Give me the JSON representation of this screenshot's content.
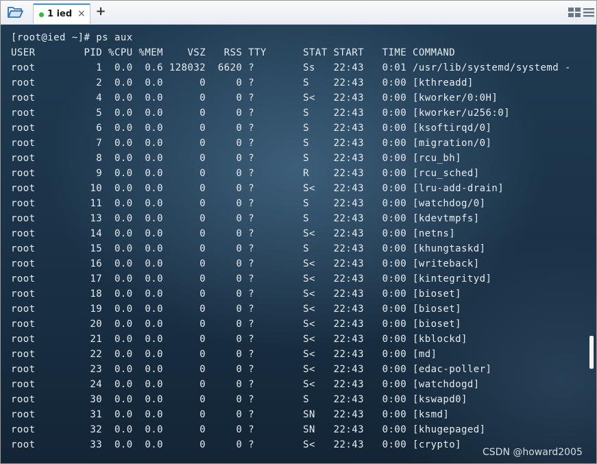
{
  "tabs": [
    {
      "label": "1 ied",
      "close_glyph": "×",
      "status_color": "#2cc12c"
    }
  ],
  "add_tab_glyph": "+",
  "icons": {
    "open": "folder-open-icon",
    "layout": "grid-layout-icon",
    "menu": "hamburger-menu-icon"
  },
  "terminal": {
    "lines": [
      "[root@ied ~]# ps aux",
      "USER        PID %CPU %MEM    VSZ   RSS TTY      STAT START   TIME COMMAND",
      "root          1  0.0  0.6 128032  6620 ?        Ss   22:43   0:01 /usr/lib/systemd/systemd -",
      "root          2  0.0  0.0      0     0 ?        S    22:43   0:00 [kthreadd]",
      "root          4  0.0  0.0      0     0 ?        S<   22:43   0:00 [kworker/0:0H]",
      "root          5  0.0  0.0      0     0 ?        S    22:43   0:00 [kworker/u256:0]",
      "root          6  0.0  0.0      0     0 ?        S    22:43   0:00 [ksoftirqd/0]",
      "root          7  0.0  0.0      0     0 ?        S    22:43   0:00 [migration/0]",
      "root          8  0.0  0.0      0     0 ?        S    22:43   0:00 [rcu_bh]",
      "root          9  0.0  0.0      0     0 ?        R    22:43   0:00 [rcu_sched]",
      "root         10  0.0  0.0      0     0 ?        S<   22:43   0:00 [lru-add-drain]",
      "root         11  0.0  0.0      0     0 ?        S    22:43   0:00 [watchdog/0]",
      "root         13  0.0  0.0      0     0 ?        S    22:43   0:00 [kdevtmpfs]",
      "root         14  0.0  0.0      0     0 ?        S<   22:43   0:00 [netns]",
      "root         15  0.0  0.0      0     0 ?        S    22:43   0:00 [khungtaskd]",
      "root         16  0.0  0.0      0     0 ?        S<   22:43   0:00 [writeback]",
      "root         17  0.0  0.0      0     0 ?        S<   22:43   0:00 [kintegrityd]",
      "root         18  0.0  0.0      0     0 ?        S<   22:43   0:00 [bioset]",
      "root         19  0.0  0.0      0     0 ?        S<   22:43   0:00 [bioset]",
      "root         20  0.0  0.0      0     0 ?        S<   22:43   0:00 [bioset]",
      "root         21  0.0  0.0      0     0 ?        S<   22:43   0:00 [kblockd]",
      "root         22  0.0  0.0      0     0 ?        S<   22:43   0:00 [md]",
      "root         23  0.0  0.0      0     0 ?        S<   22:43   0:00 [edac-poller]",
      "root         24  0.0  0.0      0     0 ?        S<   22:43   0:00 [watchdogd]",
      "root         30  0.0  0.0      0     0 ?        S    22:43   0:00 [kswapd0]",
      "root         31  0.0  0.0      0     0 ?        SN   22:43   0:00 [ksmd]",
      "root         32  0.0  0.0      0     0 ?        SN   22:43   0:00 [khugepaged]",
      "root         33  0.0  0.0      0     0 ?        S<   22:43   0:00 [crypto]"
    ]
  },
  "watermark": "CSDN @howard2005"
}
